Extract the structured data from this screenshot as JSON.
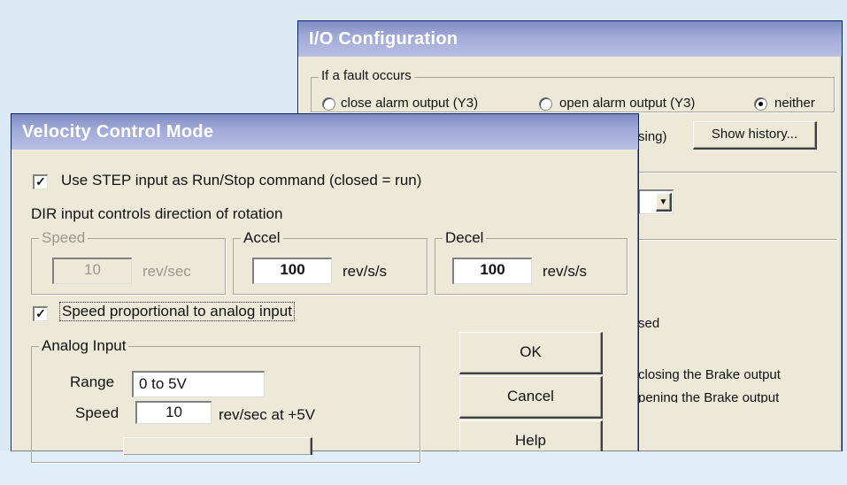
{
  "io_window": {
    "title": "I/O Configuration",
    "fault_group_label": "If a fault occurs",
    "radio_close_label": "close alarm output (Y3)",
    "radio_open_label": "open alarm output (Y3)",
    "radio_neither_label": "neither",
    "partial_text_1": "sing)",
    "show_history_label": "Show history...",
    "partial_text_2": "sed",
    "partial_text_3": "closing the Brake output",
    "partial_text_4": "pening the Brake output"
  },
  "velocity_window": {
    "title": "Velocity Control Mode",
    "use_step_label": "Use STEP input as Run/Stop command (closed = run)",
    "use_step_checked": true,
    "dir_text": "DIR input controls direction of rotation",
    "speed_group_label": "Speed",
    "speed_value": "10",
    "speed_unit": "rev/sec",
    "accel_group_label": "Accel",
    "accel_value": "100",
    "accel_unit": "rev/s/s",
    "decel_group_label": "Decel",
    "decel_value": "100",
    "decel_unit": "rev/s/s",
    "speed_prop_label": "Speed proportional to analog input",
    "speed_prop_checked": true,
    "analog_group_label": "Analog Input",
    "range_label": "Range",
    "range_value": "0 to 5V",
    "analog_speed_label": "Speed",
    "analog_speed_value": "10",
    "analog_speed_unit": "rev/sec at +5V",
    "ok_label": "OK",
    "cancel_label": "Cancel",
    "help_label": "Help",
    "check_glyph": "✓"
  }
}
